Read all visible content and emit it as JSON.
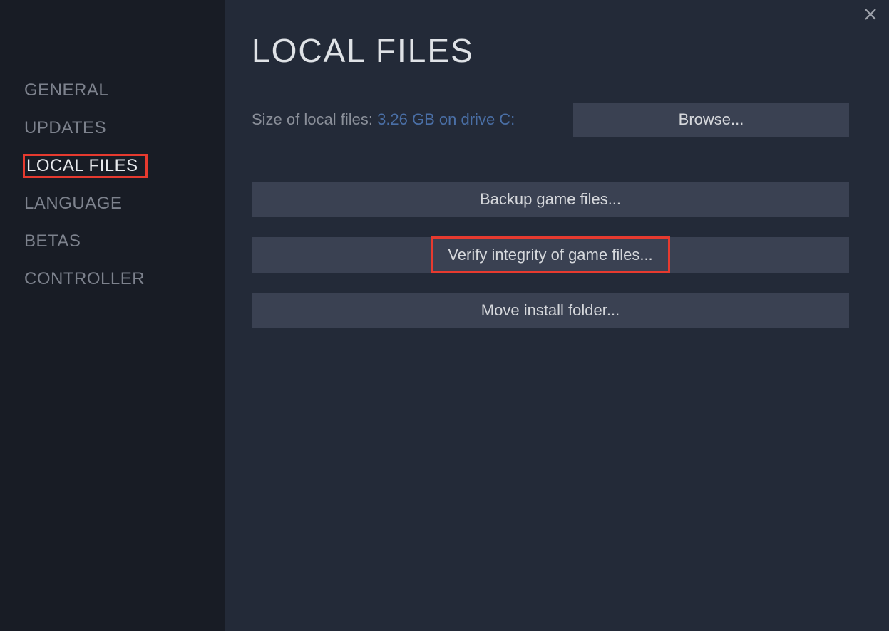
{
  "sidebar": {
    "items": [
      {
        "label": "GENERAL"
      },
      {
        "label": "UPDATES"
      },
      {
        "label": "LOCAL FILES"
      },
      {
        "label": "LANGUAGE"
      },
      {
        "label": "BETAS"
      },
      {
        "label": "CONTROLLER"
      }
    ],
    "selected_index": 2
  },
  "main": {
    "title": "LOCAL FILES",
    "size_label": "Size of local files: ",
    "size_value": "3.26 GB on drive C:",
    "browse_label": "Browse...",
    "backup_label": "Backup game files...",
    "verify_label": "Verify integrity of game files...",
    "move_label": "Move install folder..."
  },
  "highlights": {
    "sidebar_item": "LOCAL FILES",
    "main_button": "verify"
  }
}
